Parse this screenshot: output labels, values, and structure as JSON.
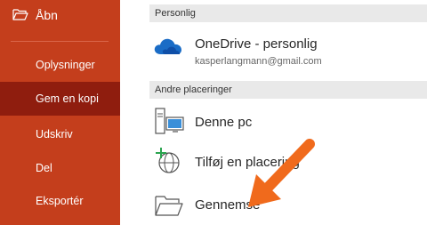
{
  "sidebar": {
    "open_label": "Åbn",
    "items": [
      {
        "label": "Oplysninger",
        "selected": false
      },
      {
        "label": "Gem en kopi",
        "selected": true
      },
      {
        "label": "Udskriv",
        "selected": false
      },
      {
        "label": "Del",
        "selected": false
      },
      {
        "label": "Eksportér",
        "selected": false
      }
    ]
  },
  "sections": {
    "personal_header": "Personlig",
    "other_header": "Andre placeringer"
  },
  "places": {
    "onedrive": {
      "title": "OneDrive - personlig",
      "account": "kasperlangmann@gmail.com",
      "icon": "onedrive-cloud-icon"
    },
    "this_pc": {
      "title": "Denne pc",
      "icon": "computer-icon"
    },
    "add_place": {
      "title": "Tilføj en placering",
      "icon": "add-place-icon"
    },
    "browse": {
      "title": "Gennemse",
      "icon": "folder-icon"
    }
  },
  "colors": {
    "sidebar": "#c43e1c",
    "sidebar_selected": "#8f1d0e",
    "annotation_arrow": "#f06a1c"
  }
}
